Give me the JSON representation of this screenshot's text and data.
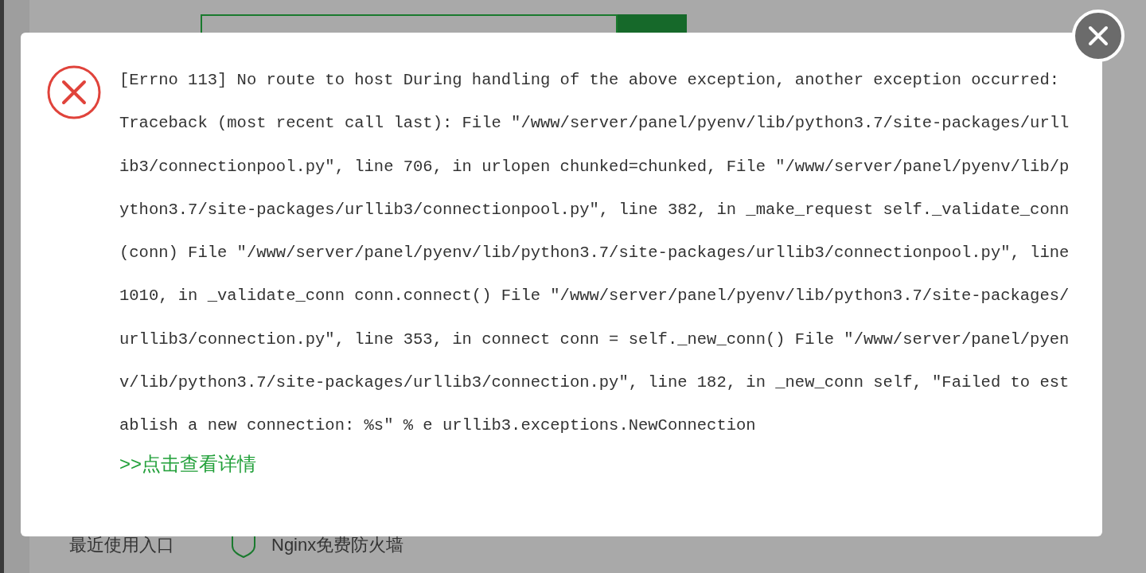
{
  "background": {
    "recent_label": "最近使用入口",
    "firewall_label": "Nginx免费防火墙"
  },
  "dialog": {
    "kind": "error",
    "message": "[Errno 113] No route to host During handling of the above exception, another exception occurred: Traceback (most recent call last): File \"/www/server/panel/pyenv/lib/python3.7/site-packages/urllib3/connectionpool.py\", line 706, in urlopen chunked=chunked, File \"/www/server/panel/pyenv/lib/python3.7/site-packages/urllib3/connectionpool.py\", line 382, in _make_request self._validate_conn(conn) File \"/www/server/panel/pyenv/lib/python3.7/site-packages/urllib3/connectionpool.py\", line 1010, in _validate_conn conn.connect() File \"/www/server/panel/pyenv/lib/python3.7/site-packages/urllib3/connection.py\", line 353, in connect conn = self._new_conn() File \"/www/server/panel/pyenv/lib/python3.7/site-packages/urllib3/connection.py\", line 182, in _new_conn self, \"Failed to establish a new connection: %s\" % e urllib3.exceptions.NewConnection",
    "details_link": ">>点击查看详情"
  }
}
